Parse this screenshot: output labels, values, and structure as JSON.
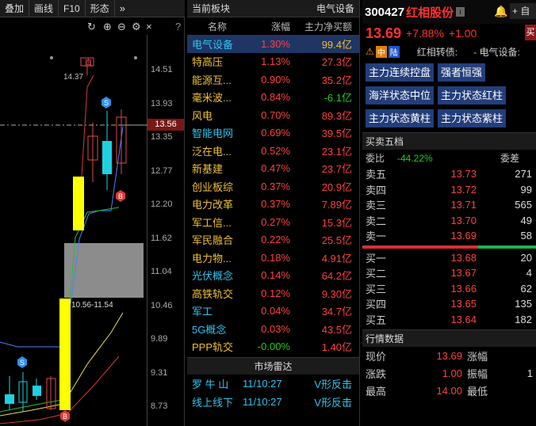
{
  "toolbar": {
    "items": [
      "叠加",
      "画线",
      "F10",
      "形态"
    ],
    "more": "»"
  },
  "chart": {
    "price_ticks": [
      "14.51",
      "13.93",
      "13.35",
      "12.77",
      "12.20",
      "11.62",
      "11.04",
      "10.46",
      "9.89",
      "9.31",
      "8.73"
    ],
    "current_price_label": "13.56",
    "high_label": "14.37",
    "zhi_label": "直",
    "range_label": "10.56-11.54",
    "close_icon": "×",
    "help_icon": "?"
  },
  "board": {
    "header_left": "当前板块",
    "header_right": "电气设备",
    "columns": [
      "名称",
      "涨幅",
      "主力净买额"
    ],
    "rows": [
      {
        "name": "电气设备",
        "pct": "1.30%",
        "net": "99.4亿",
        "name_color": "cyan",
        "net_color": "yel",
        "selected": true
      },
      {
        "name": "特高压",
        "pct": "1.13%",
        "net": "27.3亿",
        "name_color": "yel",
        "net_color": "red"
      },
      {
        "name": "能源互...",
        "pct": "0.90%",
        "net": "35.2亿",
        "name_color": "yel",
        "net_color": "red"
      },
      {
        "name": "毫米波...",
        "pct": "0.84%",
        "net": "-6.1亿",
        "name_color": "yel",
        "net_color": "grn"
      },
      {
        "name": "风电",
        "pct": "0.70%",
        "net": "89.3亿",
        "name_color": "yel",
        "net_color": "red"
      },
      {
        "name": "智能电网",
        "pct": "0.69%",
        "net": "39.5亿",
        "name_color": "cyan",
        "net_color": "red"
      },
      {
        "name": "泛在电...",
        "pct": "0.52%",
        "net": "23.1亿",
        "name_color": "yel",
        "net_color": "red"
      },
      {
        "name": "新基建",
        "pct": "0.47%",
        "net": "23.7亿",
        "name_color": "yel",
        "net_color": "red"
      },
      {
        "name": "创业板综",
        "pct": "0.37%",
        "net": "20.9亿",
        "name_color": "yel",
        "net_color": "red"
      },
      {
        "name": "电力改革",
        "pct": "0.37%",
        "net": "7.89亿",
        "name_color": "yel",
        "net_color": "red"
      },
      {
        "name": "军工信...",
        "pct": "0.27%",
        "net": "15.3亿",
        "name_color": "yel",
        "net_color": "red"
      },
      {
        "name": "军民融合",
        "pct": "0.22%",
        "net": "25.5亿",
        "name_color": "yel",
        "net_color": "red"
      },
      {
        "name": "电力物...",
        "pct": "0.18%",
        "net": "4.91亿",
        "name_color": "yel",
        "net_color": "red"
      },
      {
        "name": "光伏概念",
        "pct": "0.14%",
        "net": "64.2亿",
        "name_color": "cyan",
        "net_color": "red"
      },
      {
        "name": "高铁轨交",
        "pct": "0.12%",
        "net": "9.30亿",
        "name_color": "yel",
        "net_color": "red"
      },
      {
        "name": "军工",
        "pct": "0.04%",
        "net": "34.7亿",
        "name_color": "cyan",
        "net_color": "red"
      },
      {
        "name": "5G概念",
        "pct": "0.03%",
        "net": "43.5亿",
        "name_color": "cyan",
        "net_color": "red"
      },
      {
        "name": "PPP轨交",
        "pct": "-0.00%",
        "net": "1.40亿",
        "name_color": "yel",
        "net_color": "red",
        "pct_color": "grn"
      }
    ]
  },
  "radar": {
    "title": "市场雷达",
    "rows": [
      {
        "name": "罗 牛 山",
        "time": "11/10:27",
        "signal": "V形反击"
      },
      {
        "name": "线上线下",
        "time": "11/10:27",
        "signal": "V形反击"
      }
    ]
  },
  "quote": {
    "code": "300427",
    "name": "红相股份",
    "info_icon": "i",
    "bell_icon": "🔔",
    "add_label": "+ 自",
    "price": "13.69",
    "change_pct": "+7.88%",
    "change": "+1.00",
    "buy_tag": "买",
    "tag_zhong": "中",
    "tag_lu": "陆",
    "convertible": "红相转债:",
    "sector_short": "- 电气设备:",
    "buttons": [
      [
        "主力连续控盘",
        "强者恒强"
      ],
      [
        "海洋状态中位",
        "主力状态红柱"
      ],
      [
        "主力状态黄柱",
        "主力状态紫柱"
      ]
    ],
    "orderbook_title": "买卖五档",
    "weibi_label": "委比",
    "weibi_value": "-44.22%",
    "weicha_label": "委差",
    "asks": [
      {
        "label": "卖五",
        "price": "13.73",
        "vol": "271"
      },
      {
        "label": "卖四",
        "price": "13.72",
        "vol": "99"
      },
      {
        "label": "卖三",
        "price": "13.71",
        "vol": "565"
      },
      {
        "label": "卖二",
        "price": "13.70",
        "vol": "49"
      },
      {
        "label": "卖一",
        "price": "13.69",
        "vol": "58"
      }
    ],
    "bids": [
      {
        "label": "买一",
        "price": "13.68",
        "vol": "20"
      },
      {
        "label": "买二",
        "price": "13.67",
        "vol": "4"
      },
      {
        "label": "买三",
        "price": "13.66",
        "vol": "62"
      },
      {
        "label": "买四",
        "price": "13.65",
        "vol": "135"
      },
      {
        "label": "买五",
        "price": "13.64",
        "vol": "182"
      }
    ],
    "market_title": "行情数据",
    "stats": [
      {
        "k1": "现价",
        "v1": "13.69",
        "k2": "涨幅",
        "v2": ""
      },
      {
        "k1": "涨跌",
        "v1": "1.00",
        "k2": "振幅",
        "v2": "1"
      },
      {
        "k1": "最高",
        "v1": "14.00",
        "k2": "最低",
        "v2": ""
      }
    ]
  }
}
